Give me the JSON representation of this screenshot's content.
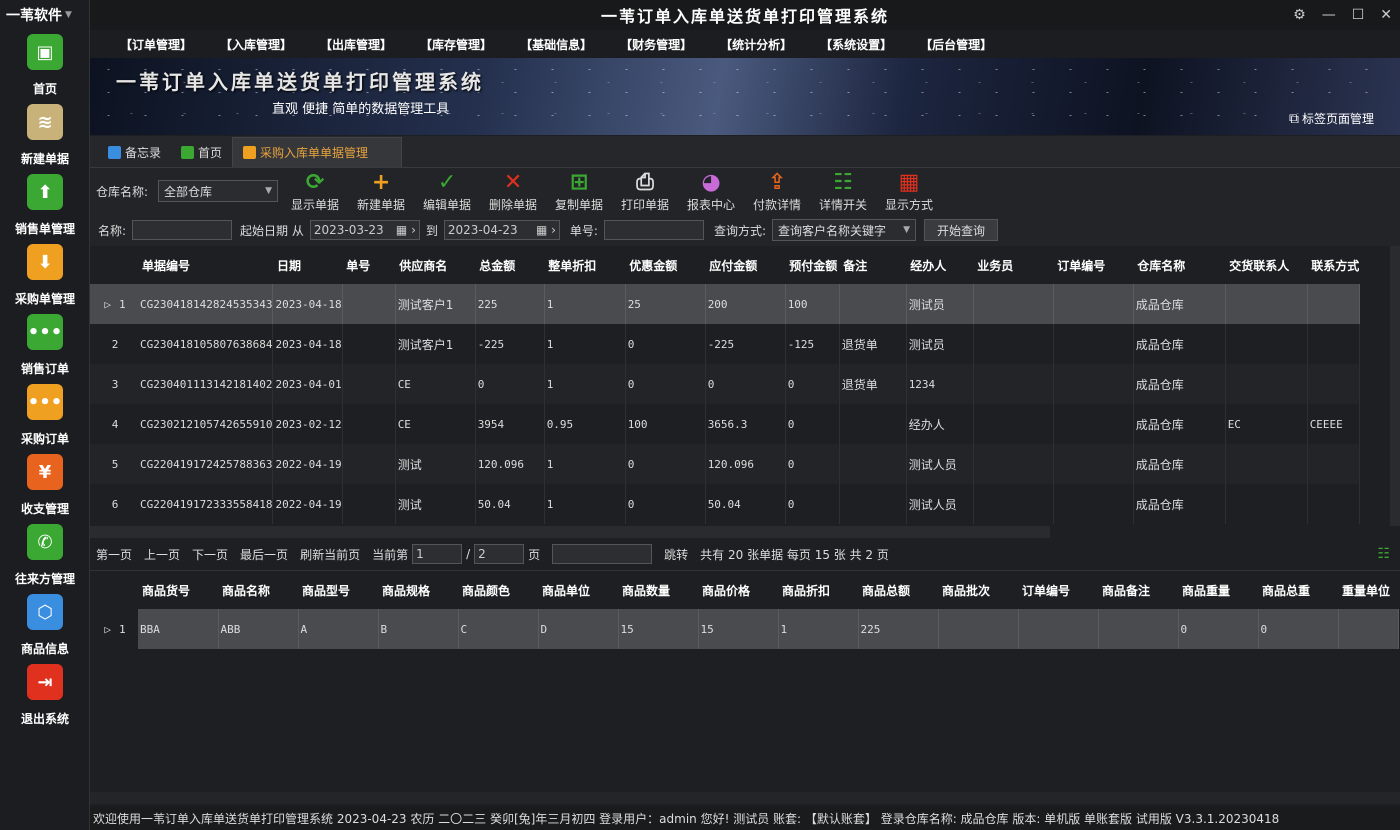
{
  "sidebar": {
    "brand": "一苇软件",
    "items": [
      {
        "label": "首页",
        "icon": "cube-icon",
        "color": "#3aa832"
      },
      {
        "label": "新建单据",
        "icon": "stack-add-icon",
        "color": "#c9b27a"
      },
      {
        "label": "销售单管理",
        "icon": "box-up-icon",
        "color": "#3aa832"
      },
      {
        "label": "采购单管理",
        "icon": "box-down-icon",
        "color": "#f0a020"
      },
      {
        "label": "销售订单",
        "icon": "chat-dots-icon",
        "color": "#3aa832"
      },
      {
        "label": "采购订单",
        "icon": "chat-dots-icon",
        "color": "#f0a020"
      },
      {
        "label": "收支管理",
        "icon": "yen-icon",
        "color": "#e8641e"
      },
      {
        "label": "往来方管理",
        "icon": "phone-icon",
        "color": "#3aa832"
      },
      {
        "label": "商品信息",
        "icon": "cubes-icon",
        "color": "#3a8ee0"
      },
      {
        "label": "退出系统",
        "icon": "exit-icon",
        "color": "#e0301e"
      }
    ]
  },
  "title": "一苇订单入库单送货单打印管理系统",
  "menu": [
    "【订单管理】",
    "【入库管理】",
    "【出库管理】",
    "【库存管理】",
    "【基础信息】",
    "【财务管理】",
    "【统计分析】",
    "【系统设置】",
    "【后台管理】"
  ],
  "banner": {
    "title": "一苇订单入库单送货单打印管理系统",
    "subtitle": "直观 便捷 简单的数据管理工具",
    "tab_manage": "标签页面管理"
  },
  "tabs": [
    {
      "label": "备忘录",
      "color": "#3a8ee0"
    },
    {
      "label": "首页",
      "color": "#3aa832"
    },
    {
      "label": "采购入库单单据管理",
      "color": "#f0a020"
    }
  ],
  "toolbar": {
    "warehouse_label": "仓库名称:",
    "warehouse_value": "全部仓库",
    "tools": [
      {
        "label": "显示单据",
        "icon": "refresh-icon",
        "glyph": "⟳",
        "color": "#3aa832"
      },
      {
        "label": "新建单据",
        "icon": "plus-icon",
        "glyph": "+",
        "color": "#f0a020"
      },
      {
        "label": "编辑单据",
        "icon": "check-icon",
        "glyph": "✓",
        "color": "#3aa832"
      },
      {
        "label": "删除单据",
        "icon": "cross-icon",
        "glyph": "✕",
        "color": "#e0301e"
      },
      {
        "label": "复制单据",
        "icon": "copy-icon",
        "glyph": "⊞",
        "color": "#3aa832"
      },
      {
        "label": "打印单据",
        "icon": "printer-icon",
        "glyph": "⎙",
        "color": "#dddddd"
      },
      {
        "label": "报表中心",
        "icon": "report-icon",
        "glyph": "◕",
        "color": "#c86ad8"
      },
      {
        "label": "付款详情",
        "icon": "payment-icon",
        "glyph": "⇪",
        "color": "#e8641e"
      },
      {
        "label": "详情开关",
        "icon": "list-check-icon",
        "glyph": "☷",
        "color": "#3aa832"
      },
      {
        "label": "显示方式",
        "icon": "grid-icon",
        "glyph": "▦",
        "color": "#e0301e"
      }
    ]
  },
  "filter": {
    "name_label": "名称:",
    "name_value": "",
    "date_label": "起始日期 从",
    "date_from": "2023-03-23",
    "to_label": "到",
    "date_to": "2023-04-23",
    "no_label": "单号:",
    "no_value": "",
    "mode_label": "查询方式:",
    "mode_value": "查询客户名称关键字",
    "search_button": "开始查询"
  },
  "main_table": {
    "columns": [
      "单据编号",
      "日期",
      "单号",
      "供应商名",
      "总金额",
      "整单折扣",
      "优惠金额",
      "应付金额",
      "预付金额",
      "备注",
      "经办人",
      "业务员",
      "订单编号",
      "仓库名称",
      "交货联系人",
      "联系方式"
    ],
    "rows": [
      [
        "1",
        "CG2304181428245353​43",
        "2023-04-18",
        "",
        "测试客户1",
        "225",
        "1",
        "25",
        "200",
        "100",
        "",
        "测试员",
        "",
        "",
        "成品仓库",
        "",
        ""
      ],
      [
        "2",
        "CG230418105807638684",
        "2023-04-18",
        "",
        "测试客户1",
        "-225",
        "1",
        "0",
        "-225",
        "-125",
        "退货单",
        "测试员",
        "",
        "",
        "成品仓库",
        "",
        ""
      ],
      [
        "3",
        "CG230401113142181402",
        "2023-04-01",
        "",
        "CE",
        "0",
        "1",
        "0",
        "0",
        "0",
        "退货单",
        "1234",
        "",
        "",
        "成品仓库",
        "",
        ""
      ],
      [
        "4",
        "CG230212105742655910",
        "2023-02-12",
        "",
        "CE",
        "3954",
        "0.95",
        "100",
        "3656.3",
        "0",
        "",
        "经办人",
        "",
        "",
        "成品仓库",
        "EC",
        "CEEEE"
      ],
      [
        "5",
        "CG220419172425788363",
        "2022-04-19",
        "",
        "测试",
        "120.096",
        "1",
        "0",
        "120.096",
        "0",
        "",
        "测试人员",
        "",
        "",
        "成品仓库",
        "",
        ""
      ],
      [
        "6",
        "CG220419172333558418",
        "2022-04-19",
        "",
        "测试",
        "50.04",
        "1",
        "0",
        "50.04",
        "0",
        "",
        "测试人员",
        "",
        "",
        "成品仓库",
        "",
        ""
      ]
    ]
  },
  "pager": {
    "first": "第一页",
    "prev": "上一页",
    "next": "下一页",
    "last": "最后一页",
    "refresh": "刷新当前页",
    "current_label": "当前第",
    "current": "1",
    "slash": "/",
    "total_pages": "2",
    "page_unit": "页",
    "jump_value": "",
    "jump": "跳转",
    "summary": "共有 20 张单据 每页 15 张 共 2 页"
  },
  "detail_table": {
    "columns": [
      "商品货号",
      "商品名称",
      "商品型号",
      "商品规格",
      "商品颜色",
      "商品单位",
      "商品数量",
      "商品价格",
      "商品折扣",
      "商品总额",
      "商品批次",
      "订单编号",
      "商品备注",
      "商品重量",
      "商品总重",
      "重量单位"
    ],
    "rows": [
      [
        "1",
        "BBA",
        "ABB",
        "A",
        "B",
        "C",
        "D",
        "15",
        "15",
        "1",
        "225",
        "",
        "",
        "",
        "0",
        "0",
        ""
      ]
    ]
  },
  "status": "欢迎使用一苇订单入库单送货单打印管理系统 2023-04-23 农历 二〇二三 癸卯[兔]年三月初四 登录用户：admin 您好! 测试员 账套: 【默认账套】 登录仓库名称: 成品仓库 版本: 单机版 单账套版 试用版 V3.3.1.20230418"
}
